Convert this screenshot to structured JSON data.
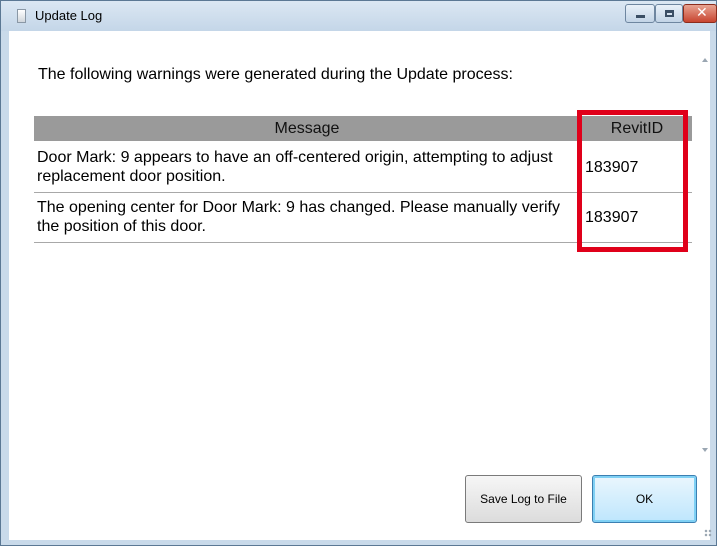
{
  "window": {
    "title": "Update Log"
  },
  "heading": "The following warnings were generated during the Update process:",
  "table": {
    "headers": {
      "message": "Message",
      "revit_id": "RevitID"
    },
    "rows": [
      {
        "message": "Door Mark: 9 appears to have an off-centered origin, attempting to adjust replacement door position.",
        "revit_id": "183907"
      },
      {
        "message": "The opening center for Door Mark: 9 has changed. Please manually verify the position of this door.",
        "revit_id": "183907"
      }
    ]
  },
  "buttons": {
    "save_log": "Save Log to File",
    "ok": "OK",
    "close_glyph": "✕"
  },
  "colors": {
    "highlight_box": "#e0001a",
    "header_bg": "#9a9a9a",
    "ok_button_accent": "#7fd0f4"
  }
}
